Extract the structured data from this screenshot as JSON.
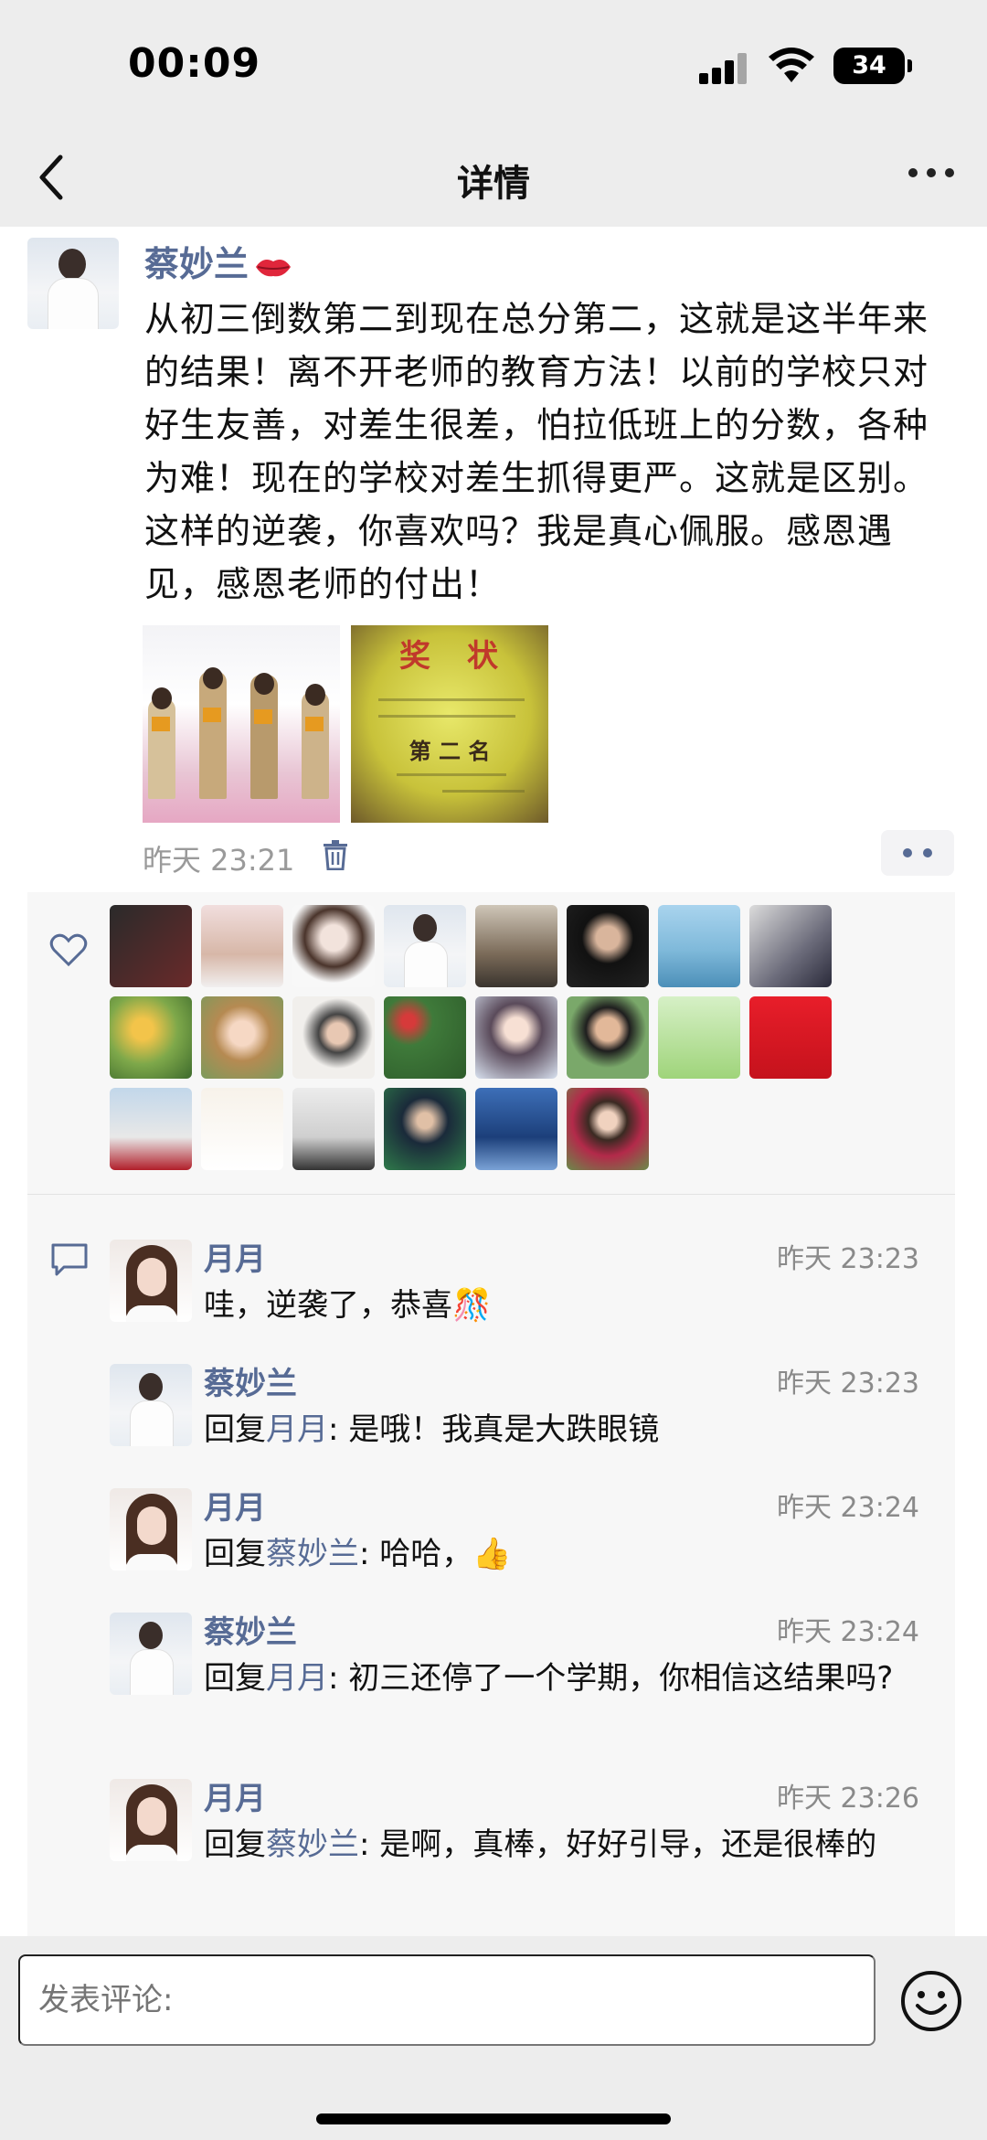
{
  "status_bar": {
    "time": "00:09",
    "battery": "34"
  },
  "nav": {
    "title": "详情"
  },
  "post": {
    "author": "蔡妙兰",
    "text": "从初三倒数第二到现在总分第二，这就是这半年来的结果！离不开老师的教育方法！以前的学校只对好生友善，对差生很差，怕拉低班上的分数，各种为难！现在的学校对差生抓得更严。这就是区别。这样的逆袭，你喜欢吗？我是真心佩服。感恩遇见，感恩老师的付出！",
    "time": "昨天 23:21",
    "photo2_title": "奖状",
    "photo2_rank": "第 二 名"
  },
  "likes_count": 22,
  "comments": [
    {
      "name": "月月",
      "time": "昨天 23:23",
      "reply_prefix": "",
      "reply_to": "",
      "text": "哇，逆袭了，恭喜🎊",
      "avatar": "yue"
    },
    {
      "name": "蔡妙兰",
      "time": "昨天 23:23",
      "reply_prefix": "回复",
      "reply_to": "月月",
      "text": ": 是哦！我真是大跌眼镜",
      "avatar": "cai"
    },
    {
      "name": "月月",
      "time": "昨天 23:24",
      "reply_prefix": "回复",
      "reply_to": "蔡妙兰",
      "text": ": 哈哈，👍",
      "avatar": "yue"
    },
    {
      "name": "蔡妙兰",
      "time": "昨天 23:24",
      "reply_prefix": "回复",
      "reply_to": "月月",
      "text": ": 初三还停了一个学期，你相信这结果吗?",
      "avatar": "cai"
    },
    {
      "name": "月月",
      "time": "昨天 23:26",
      "reply_prefix": "回复",
      "reply_to": "蔡妙兰",
      "text": ": 是啊，真棒，好好引导，还是很棒的",
      "avatar": "yue"
    }
  ],
  "input": {
    "placeholder": "发表评论:"
  }
}
